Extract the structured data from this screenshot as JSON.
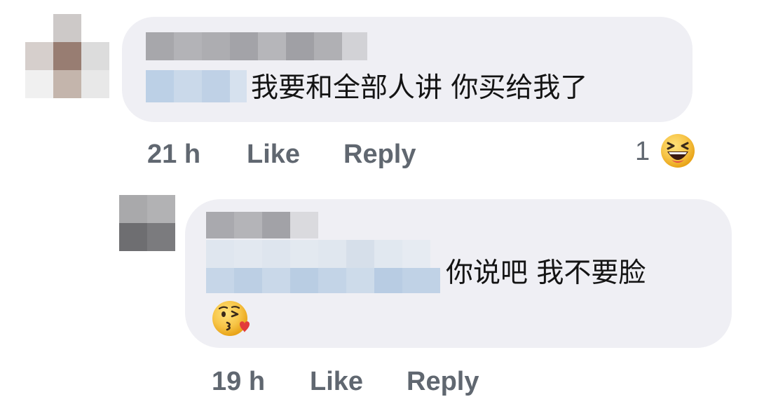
{
  "comment": {
    "text": "我要和全部人讲 你买给我了",
    "timestamp": "21 h",
    "like_label": "Like",
    "reply_label": "Reply",
    "reaction_count": "1",
    "reaction_icon": "haha-icon"
  },
  "reply": {
    "text": "你说吧 我不要脸",
    "emoji": "kissing-heart-emoji",
    "timestamp": "19 h",
    "like_label": "Like",
    "reply_label": "Reply"
  },
  "colors": {
    "bubble": "#efeff4",
    "meta_text": "#606770",
    "body_text": "#141414"
  }
}
